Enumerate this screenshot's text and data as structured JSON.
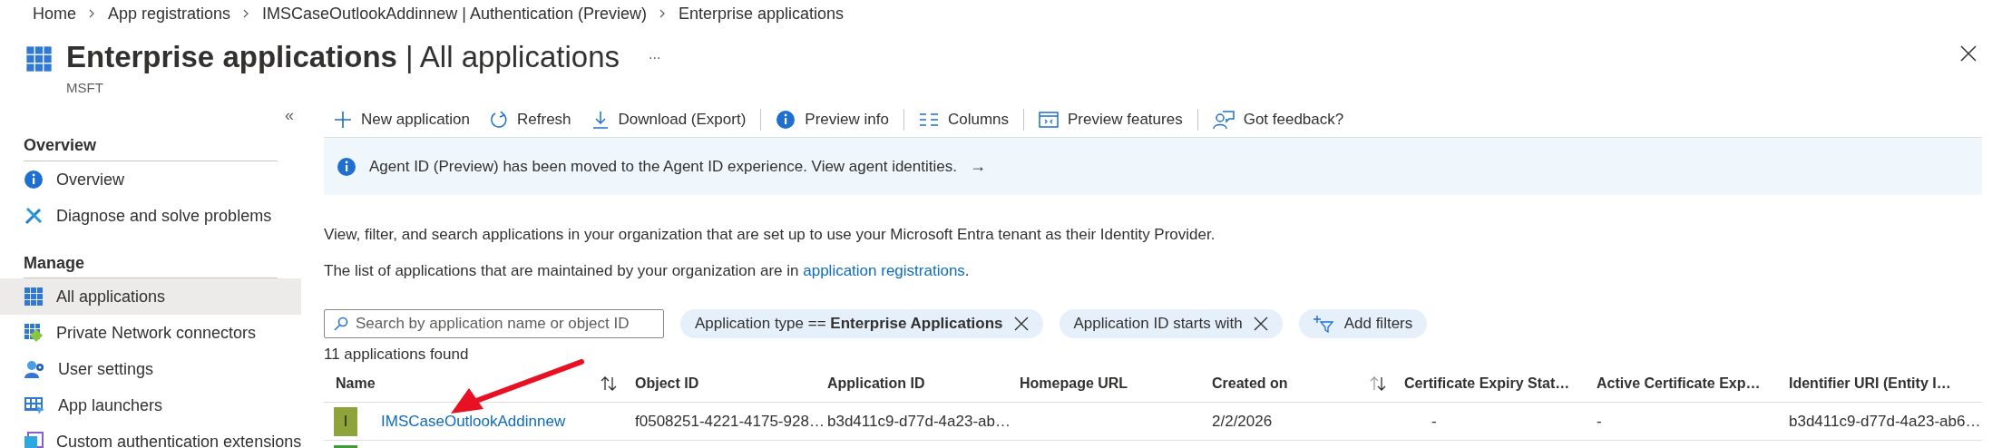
{
  "breadcrumb": [
    "Home",
    "App registrations",
    "IMSCaseOutlookAddinnew | Authentication (Preview)",
    "Enterprise applications"
  ],
  "header": {
    "title": "Enterprise applications",
    "title_suffix": "| All applications",
    "subtitle": "MSFT",
    "more": "..."
  },
  "sidebar": {
    "collapse": "«",
    "sections": [
      {
        "heading": "Overview",
        "items": [
          {
            "label": "Overview",
            "kind": "info",
            "selected": false
          },
          {
            "label": "Diagnose and solve problems",
            "kind": "wrench",
            "selected": false
          }
        ]
      },
      {
        "heading": "Manage",
        "items": [
          {
            "label": "All applications",
            "kind": "grid",
            "selected": true
          },
          {
            "label": "Private Network connectors",
            "kind": "network",
            "selected": false
          },
          {
            "label": "User settings",
            "kind": "user",
            "selected": false
          },
          {
            "label": "App launchers",
            "kind": "launcher",
            "selected": false
          },
          {
            "label": "Custom authentication extensions",
            "kind": "extension",
            "selected": false
          }
        ]
      }
    ]
  },
  "toolbar": [
    [
      {
        "label": "New application",
        "kind": "plus"
      },
      {
        "label": "Refresh",
        "kind": "refresh"
      },
      {
        "label": "Download (Export)",
        "kind": "download"
      }
    ],
    [
      {
        "label": "Preview info",
        "kind": "info"
      }
    ],
    [
      {
        "label": "Columns",
        "kind": "columns"
      }
    ],
    [
      {
        "label": "Preview features",
        "kind": "preview"
      }
    ],
    [
      {
        "label": "Got feedback?",
        "kind": "feedback"
      }
    ]
  ],
  "banner": {
    "text": "Agent ID (Preview) has been moved to the Agent ID experience. View agent identities.",
    "arrow": "→"
  },
  "description": [
    {
      "text": "View, filter, and search applications in your organization that are set up to use your Microsoft Entra tenant as their Identity Provider."
    },
    {
      "text": "The list of applications that are maintained by your organization are in ",
      "link": "application registrations",
      "after": "."
    }
  ],
  "search": {
    "placeholder": "Search by application name or object ID"
  },
  "filters": [
    {
      "kind": "pill",
      "text": "Application type == **Enterprise Applications**",
      "removable": true
    },
    {
      "kind": "pill",
      "text": "Application ID starts with",
      "removable": true
    },
    {
      "kind": "add",
      "text": "Add filters",
      "removable": false
    }
  ],
  "result_count": "11 applications found",
  "table": {
    "columns": [
      {
        "label": "Name",
        "sortable": true
      },
      {
        "label": "Object ID",
        "sortable": false
      },
      {
        "label": "Application ID",
        "sortable": false
      },
      {
        "label": "Homepage URL",
        "sortable": false
      },
      {
        "label": "Created on",
        "sortable": true
      },
      {
        "label": "Certificate Expiry Stat…",
        "sortable": false
      },
      {
        "label": "Active Certificate Exp…",
        "sortable": false
      },
      {
        "label": "Identifier URI (Entity I…",
        "sortable": false
      }
    ],
    "rows": [
      {
        "avatar": "I",
        "color": "#8ea43a",
        "name": "IMSCaseOutlookAddinnew",
        "object_id": "f0508251-4221-4175-928…",
        "application_id": "b3d411c9-d77d-4a23-ab…",
        "created_on": "2/2/2026",
        "certificate_expiry_status": "-",
        "active_certificate_expiry": "-",
        "identifier_uri": "b3d411c9-d77d-4a23-ab6…"
      },
      {
        "color": "#3c9c3a"
      }
    ]
  }
}
